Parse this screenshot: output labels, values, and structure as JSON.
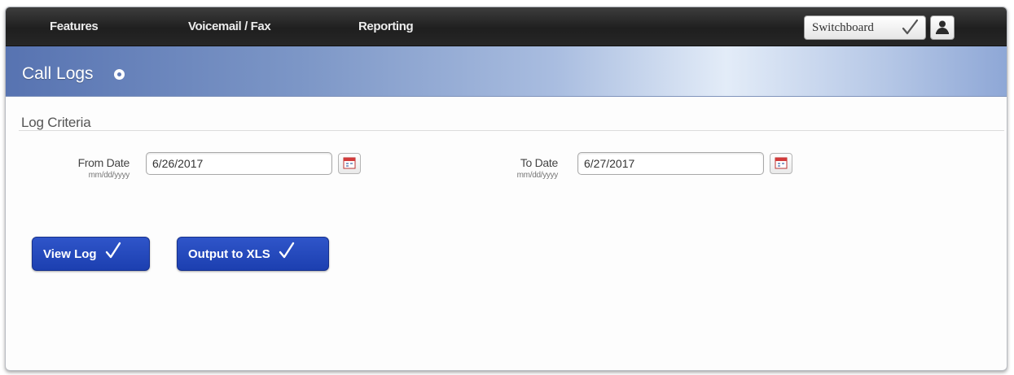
{
  "nav": {
    "items": [
      {
        "label": "Features"
      },
      {
        "label": "Voicemail / Fax"
      },
      {
        "label": "Reporting"
      }
    ],
    "switchboard_label": "Switchboard"
  },
  "page": {
    "title": "Call Logs"
  },
  "criteria": {
    "section_label": "Log Criteria",
    "from": {
      "label": "From Date",
      "hint": "mm/dd/yyyy",
      "value": "6/26/2017"
    },
    "to": {
      "label": "To Date",
      "hint": "mm/dd/yyyy",
      "value": "6/27/2017"
    }
  },
  "actions": {
    "view_log_label": "View Log",
    "output_xls_label": "Output to XLS"
  },
  "icons": {
    "help": "help-icon",
    "user": "user-icon",
    "calendar": "calendar-icon",
    "check": "check-icon"
  },
  "colors": {
    "nav_bg": "#262626",
    "title_band": "#5773b1",
    "button_blue": "#2446bc",
    "calendar_red": "#d23b3b"
  }
}
